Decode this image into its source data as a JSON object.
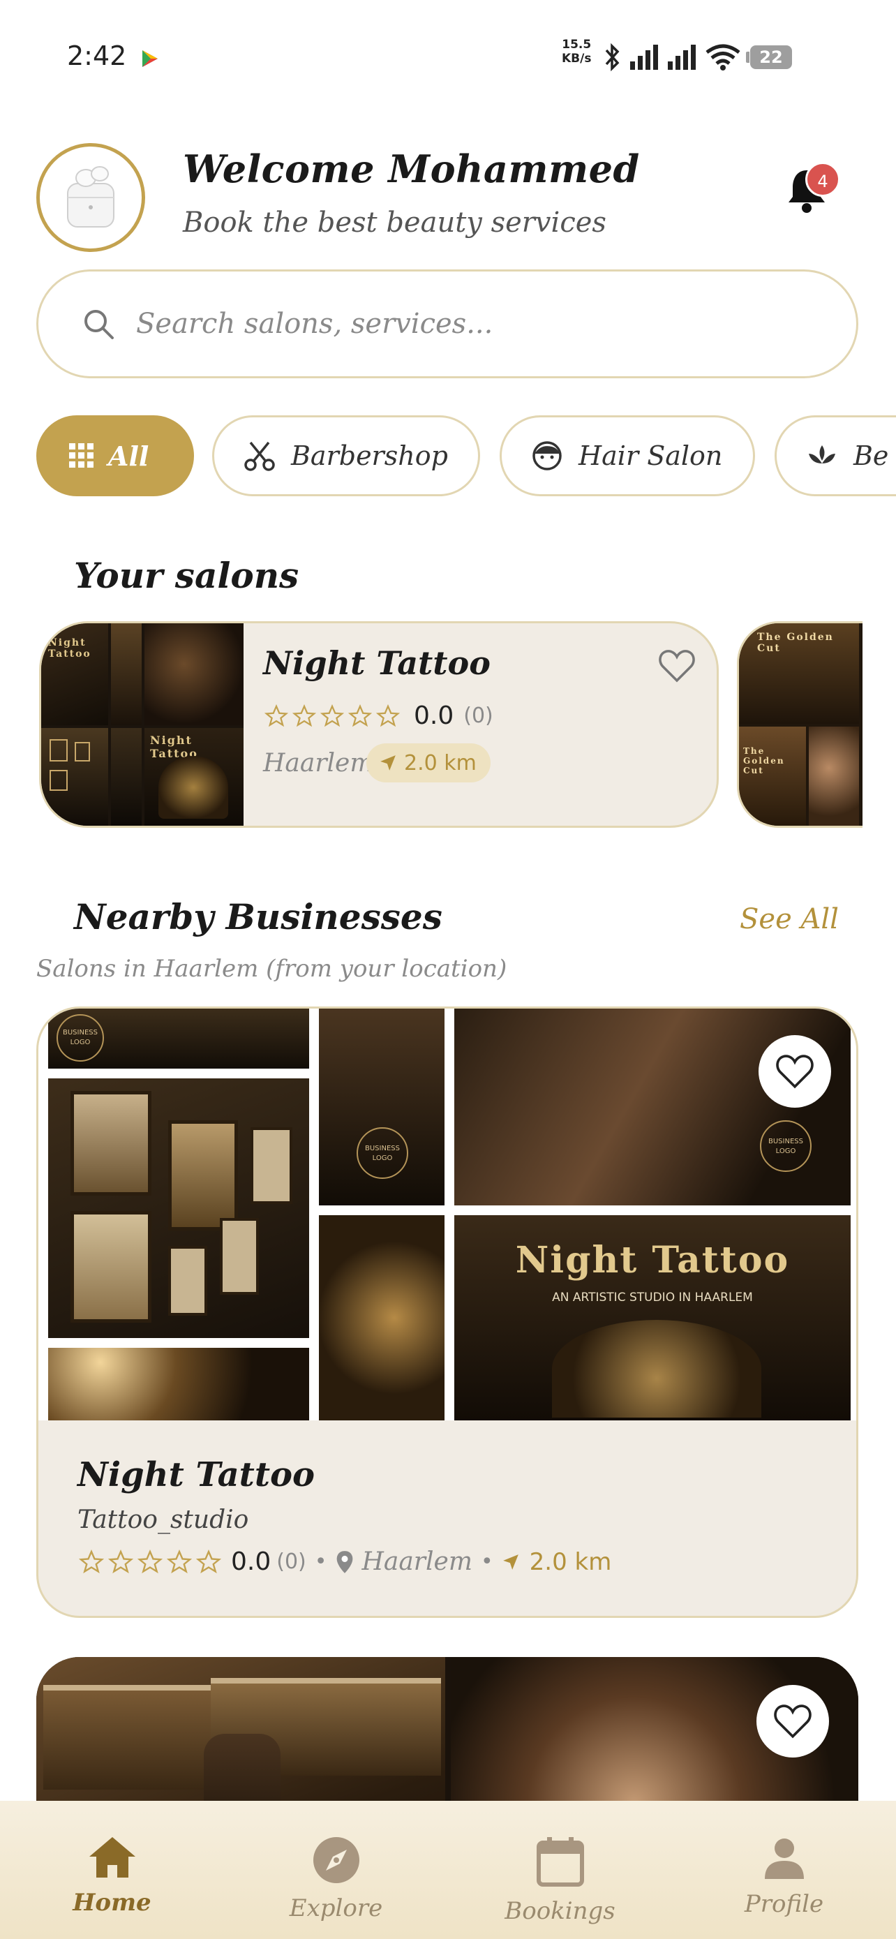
{
  "status_bar": {
    "time": "2:42",
    "net_speed_value": "15.5",
    "net_speed_unit": "KB/s",
    "battery": "22"
  },
  "header": {
    "welcome": "Welcome Mohammed",
    "subtitle": "Book the best beauty services",
    "notification_count": "4"
  },
  "search": {
    "placeholder": "Search salons, services..."
  },
  "categories": [
    {
      "label": "All",
      "icon": "grid-icon",
      "active": true
    },
    {
      "label": "Barbershop",
      "icon": "scissors-icon",
      "active": false
    },
    {
      "label": "Hair Salon",
      "icon": "face-icon",
      "active": false
    },
    {
      "label": "Be",
      "icon": "lotus-icon",
      "active": false
    }
  ],
  "your_salons": {
    "title": "Your salons",
    "items": [
      {
        "name": "Night Tattoo",
        "rating": "0.0",
        "reviews": "(0)",
        "city": "Haarlem",
        "distance": "2.0 km",
        "image_text_top": "Night Tattoo",
        "image_text_bottom": "Night Tattoo"
      }
    ],
    "peek_image_text_top": "The Golden Cut",
    "peek_image_text_bottom": "The Golden Cut"
  },
  "nearby": {
    "title": "Nearby Businesses",
    "see_all": "See All",
    "subtitle": "Salons in Haarlem (from your location)",
    "items": [
      {
        "name": "Night Tattoo",
        "type": "Tattoo_studio",
        "rating": "0.0",
        "reviews": "(0)",
        "city": "Haarlem",
        "distance": "2.0 km",
        "banner_title": "Night Tattoo",
        "banner_subtitle": "AN ARTISTIC STUDIO IN HAARLEM",
        "logo_text": "BUSINESS LOGO"
      }
    ]
  },
  "bottom_nav": [
    {
      "label": "Home",
      "icon": "home-icon",
      "active": true
    },
    {
      "label": "Explore",
      "icon": "compass-icon",
      "active": false
    },
    {
      "label": "Bookings",
      "icon": "calendar-icon",
      "active": false
    },
    {
      "label": "Profile",
      "icon": "person-icon",
      "active": false
    }
  ],
  "colors": {
    "accent": "#c3a24f",
    "card_bg": "#f1ece4",
    "border": "#e2d6b2",
    "badge": "#d9534f",
    "gold_text": "#b3913b"
  }
}
